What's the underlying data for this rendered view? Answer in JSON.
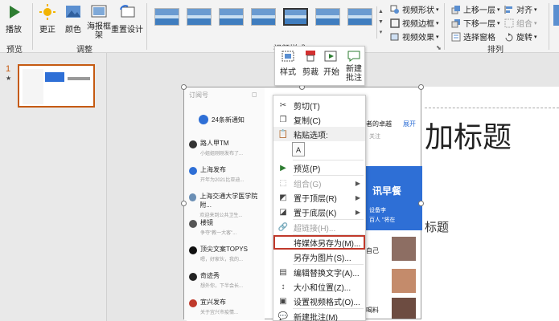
{
  "ribbon": {
    "preview_group": {
      "play_label": "播放",
      "group_label": "预览"
    },
    "adjust_group": {
      "correct_label": "更正",
      "color_label": "颜色",
      "poster_label": "海报框\n架",
      "reset_label": "重置设计",
      "group_label": "调整"
    },
    "styles_group": {
      "group_label": "视频样式"
    },
    "format_cmds": {
      "shape": "视频形状",
      "border": "视频边框",
      "effects": "视频效果"
    },
    "arrange_group": {
      "bring_forward": "上移一层",
      "send_backward": "下移一层",
      "selection_pane": "选择窗格",
      "align": "对齐",
      "group": "组合",
      "rotate": "旋转",
      "group_label": "排列"
    }
  },
  "slides_pane": {
    "slide_number": "1",
    "star": "★"
  },
  "mini_toolbar": {
    "style": "样式",
    "crop": "剪裁",
    "start": "开始",
    "new_comment": "新建\n批注"
  },
  "context_menu": {
    "cut": "剪切(T)",
    "copy": "复制(C)",
    "paste_options": "粘贴选项:",
    "preview": "预览(P)",
    "group": "组合(G)",
    "bring_to_front": "置于顶层(R)",
    "send_to_back": "置于底层(K)",
    "hyperlink": "超链接(H)...",
    "save_media_as": "将媒体另存为(M)...",
    "save_as_picture": "另存为图片(S)...",
    "edit_alt_text": "编辑替换文字(A)...",
    "size_position": "大小和位置(Z)...",
    "format_video": "设置视频格式(O)...",
    "new_comment": "新建批注(M)"
  },
  "slide": {
    "title_placeholder": "加标题",
    "subtitle_placeholder": "标题"
  },
  "video": {
    "header": "订阅号",
    "notice": "24条新通知",
    "accounts": [
      {
        "name": "路人甲TM",
        "sub": "小姐姐刚刚发布了...",
        "color": "#333333"
      },
      {
        "name": "上海发布",
        "sub": "开年为2021比亚迪...",
        "color": "#2e6fd6"
      },
      {
        "name": "上海交通大学医学院附...",
        "sub": "欢迎来到公共卫生...",
        "color": "#6b8fb5"
      },
      {
        "name": "楼镜",
        "sub": "争夺\"教一大客\"...",
        "color": "#555555"
      },
      {
        "name": "顶尖文案TOPYS",
        "sub": "嗯，好家伙，我的...",
        "color": "#111111"
      },
      {
        "name": "奇迹秀",
        "sub": "想外你，下半会长...",
        "color": "#222222"
      },
      {
        "name": "宜兴发布",
        "sub": "关于宜兴市疫情...",
        "color": "#c0392b"
      }
    ],
    "right_texts": {
      "top": "与者的卓越",
      "expand": "展开",
      "follow": "关注",
      "banner": "讯早餐",
      "banner2": "设备李",
      "banner3": "百人 \"将在",
      "self": "自己",
      "bottom": "喝料"
    }
  }
}
